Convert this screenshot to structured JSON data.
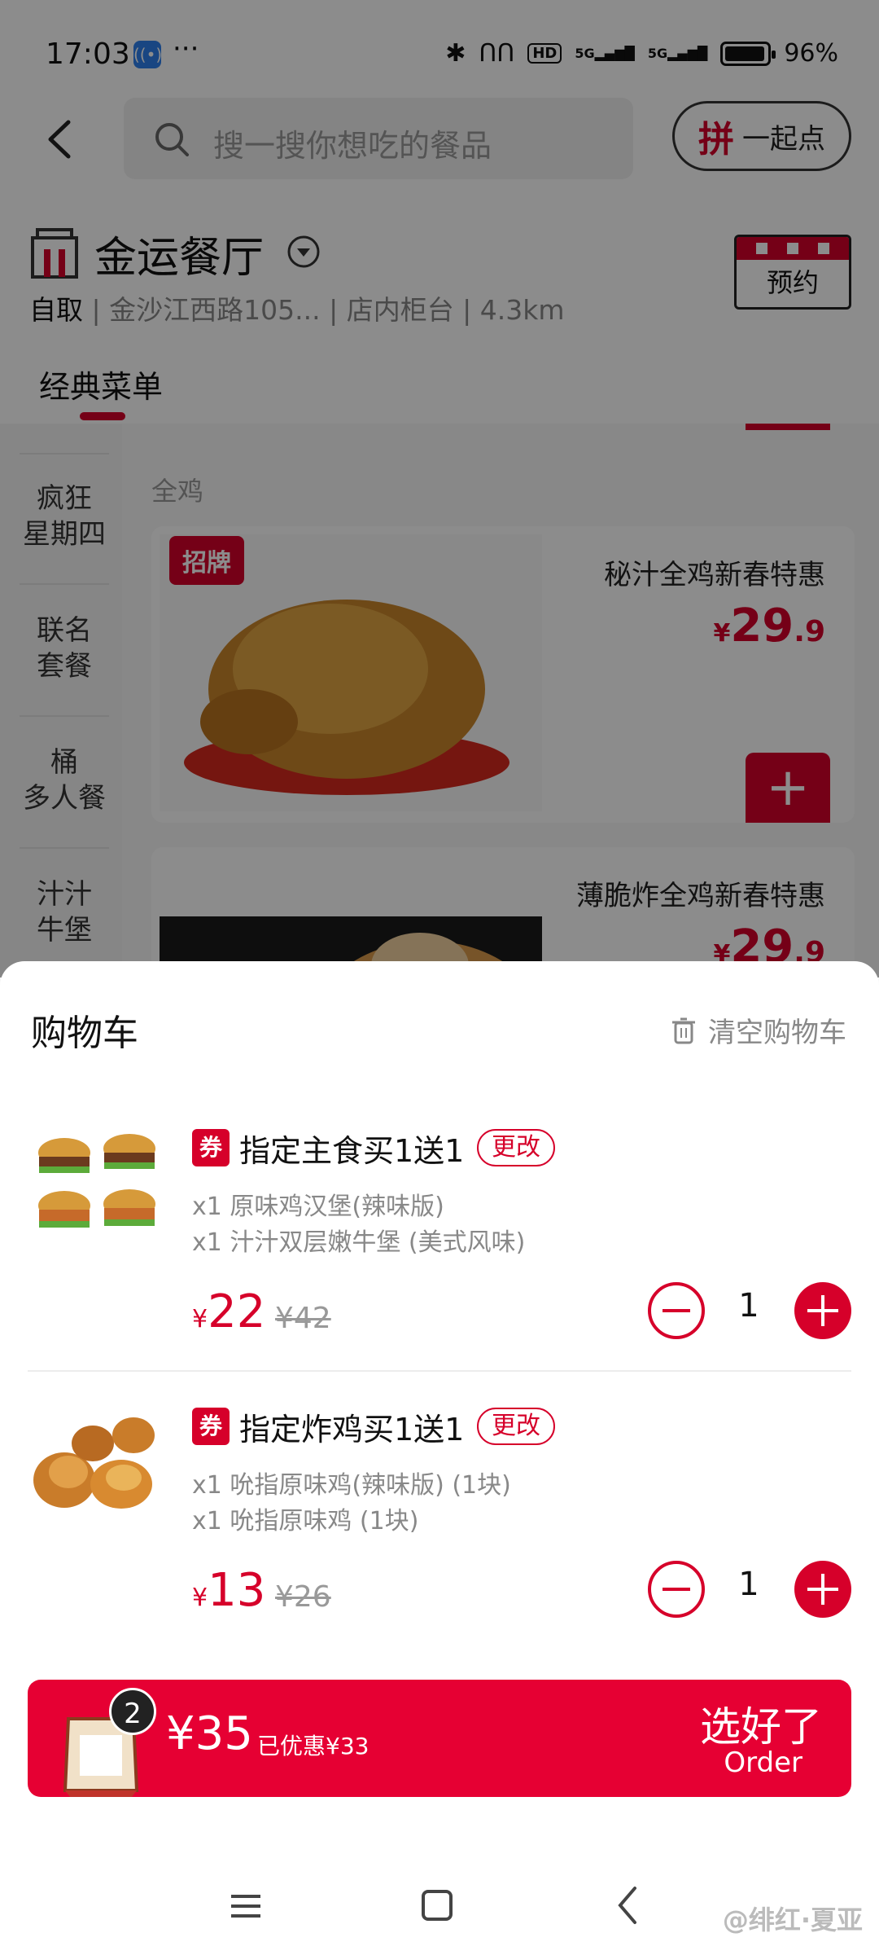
{
  "status_bar": {
    "time": "17:03",
    "dots": "···",
    "hd": "HD",
    "net1": "5G",
    "net2": "5G",
    "battery": "96%"
  },
  "header": {
    "search_placeholder": "搜一搜你想吃的餐品",
    "together_icon": "拼",
    "together_label": "一起点"
  },
  "store": {
    "name": "金运餐厅",
    "mode": "自取",
    "address": "金沙江西路105...",
    "pickup": "店内柜台",
    "distance": "4.3km",
    "reserve_label": "预约"
  },
  "menu_tab": "经典菜单",
  "sidebar": {
    "items": [
      "疯狂\n星期四",
      "联名\n套餐",
      "桶\n多人餐",
      "汁汁\n牛堡"
    ]
  },
  "category_label": "全鸡",
  "products": [
    {
      "badge": "招牌",
      "name": "秘汁全鸡新春特惠",
      "yen": "¥",
      "price_int": "29",
      "price_dec": ".9"
    },
    {
      "name": "薄脆炸全鸡新春特惠",
      "yen": "¥",
      "price_int": "29",
      "price_dec": ".9"
    }
  ],
  "cart": {
    "title": "购物车",
    "clear_label": "清空购物车",
    "items": [
      {
        "coupon": "券",
        "title": "指定主食买1送1",
        "change": "更改",
        "details": [
          "x1 原味鸡汉堡(辣味版)",
          "x1 汁汁双层嫩牛堡 (美式风味)"
        ],
        "yen": "¥",
        "price": "22",
        "original": "¥42",
        "qty": "1"
      },
      {
        "coupon": "券",
        "title": "指定炸鸡买1送1",
        "change": "更改",
        "details": [
          "x1 吮指原味鸡(辣味版) (1块)",
          "x1 吮指原味鸡 (1块)"
        ],
        "yen": "¥",
        "price": "13",
        "original": "¥26",
        "qty": "1"
      }
    ]
  },
  "checkout": {
    "count": "2",
    "total": "¥35",
    "saved": "已优惠¥33",
    "confirm": "选好了",
    "confirm_en": "Order"
  },
  "watermark": "@绯红·夏亚",
  "colors": {
    "brand_red": "#d6002a",
    "checkout_red": "#e60033"
  }
}
